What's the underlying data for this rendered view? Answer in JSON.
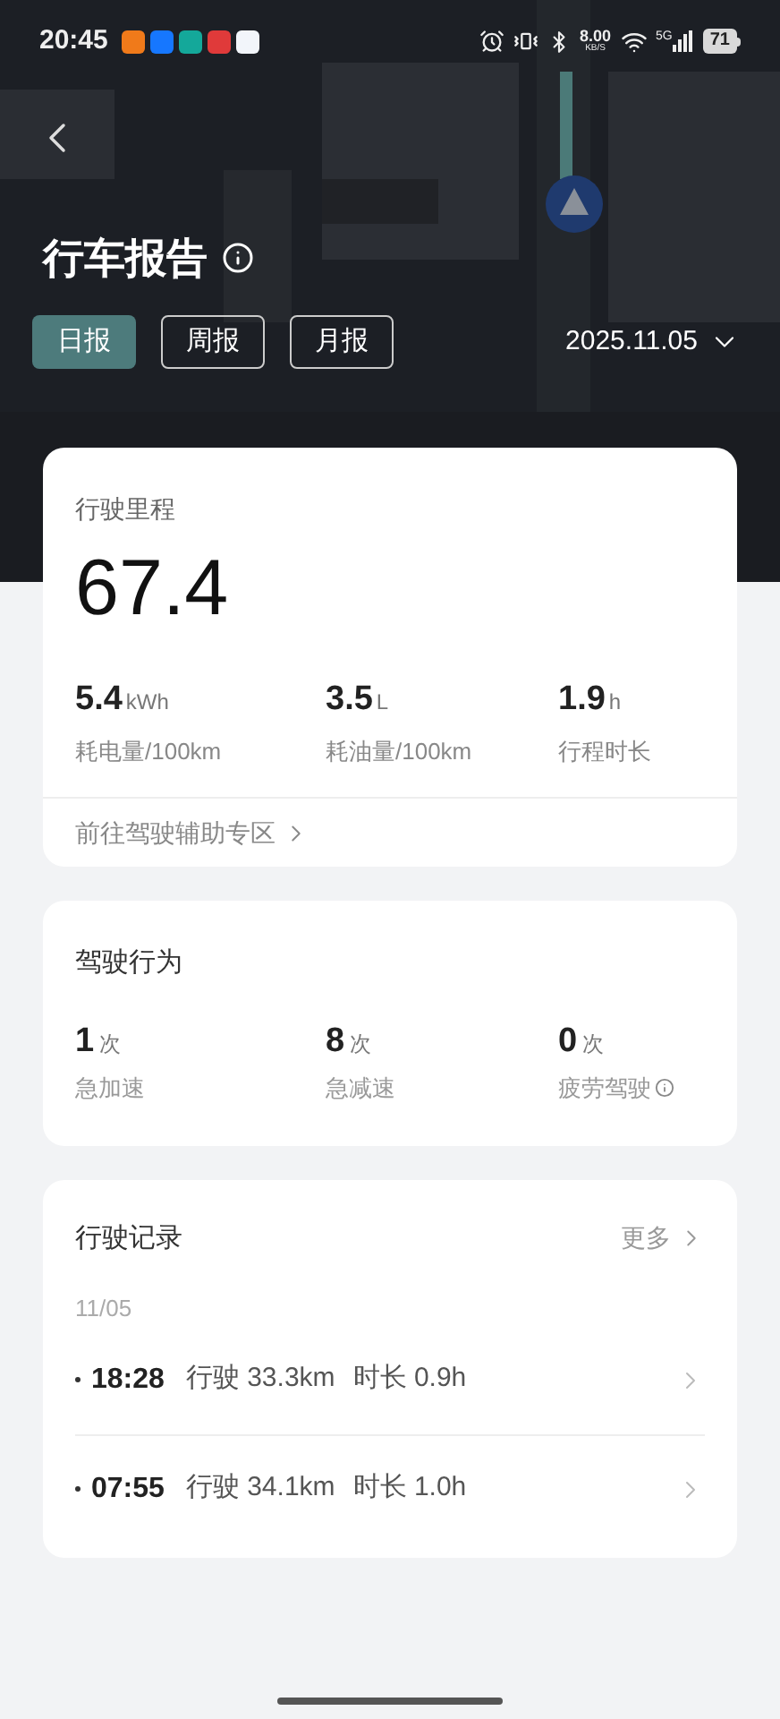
{
  "status_bar": {
    "time": "20:45",
    "network_speed": "8.00",
    "speed_unit": "KB/S",
    "signal_label": "5G",
    "battery": "71"
  },
  "header": {
    "title": "行车报告"
  },
  "tabs": [
    {
      "label": "日报",
      "selected": true
    },
    {
      "label": "周报",
      "selected": false
    },
    {
      "label": "月报",
      "selected": false
    }
  ],
  "date_picker": {
    "value": "2025.11.05"
  },
  "mileage_card": {
    "label": "行驶里程",
    "value": "67.4",
    "metrics": [
      {
        "value": "5.4",
        "unit": "kWh",
        "label": "耗电量/100km"
      },
      {
        "value": "3.5",
        "unit": "L",
        "label": "耗油量/100km"
      },
      {
        "value": "1.9",
        "unit": "h",
        "label": "行程时长"
      }
    ],
    "link": "前往驾驶辅助专区"
  },
  "behavior_card": {
    "title": "驾驶行为",
    "items": [
      {
        "value": "1",
        "unit": "次",
        "label": "急加速",
        "info": false
      },
      {
        "value": "8",
        "unit": "次",
        "label": "急减速",
        "info": false
      },
      {
        "value": "0",
        "unit": "次",
        "label": "疲劳驾驶",
        "info": true
      }
    ]
  },
  "records_card": {
    "title": "行驶记录",
    "more": "更多",
    "date": "11/05",
    "trips": [
      {
        "time": "18:28",
        "distance": "行驶 33.3km",
        "duration": "时长 0.9h"
      },
      {
        "time": "07:55",
        "distance": "行驶 34.1km",
        "duration": "时长 1.0h"
      }
    ]
  }
}
